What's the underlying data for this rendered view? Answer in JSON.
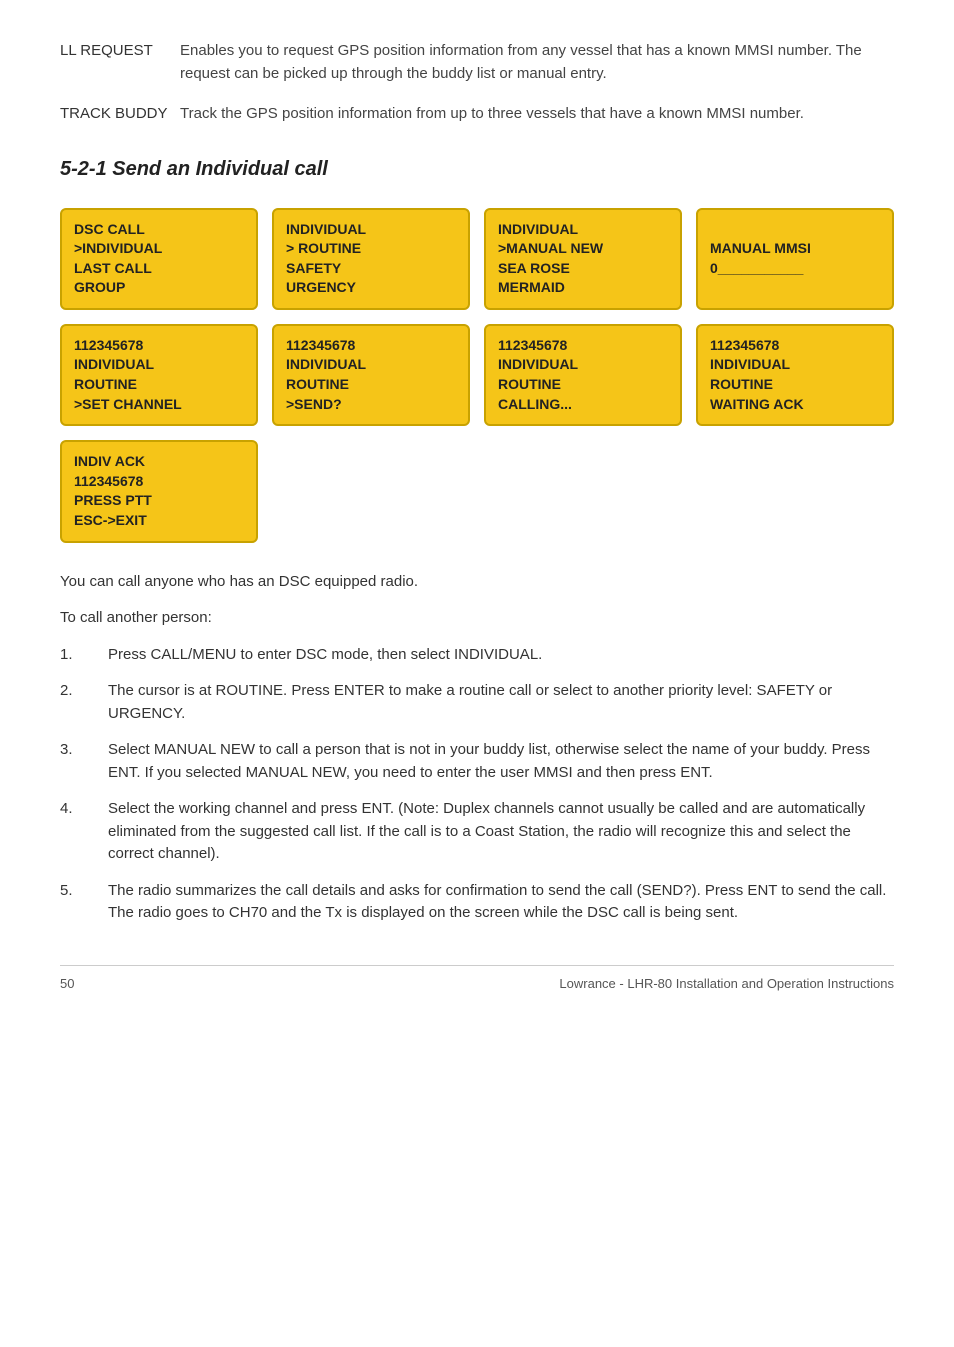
{
  "definitions": [
    {
      "term": "LL REQUEST",
      "description": "Enables you to request GPS position information from any vessel that has a known MMSI number.  The request can be picked up through the buddy list or manual entry."
    },
    {
      "term": "TRACK BUDDY",
      "description": "Track the GPS position information from up to three vessels that have a known MMSI number."
    }
  ],
  "section_heading": "5-2-1 Send an Individual call",
  "lcd_row1": [
    {
      "lines": [
        "DSC CALL",
        ">INDIVIDUAL",
        "LAST CALL",
        "GROUP"
      ]
    },
    {
      "lines": [
        "INDIVIDUAL",
        "> ROUTINE",
        "SAFETY",
        "URGENCY"
      ]
    },
    {
      "lines": [
        "INDIVIDUAL",
        ">MANUAL NEW",
        "SEA ROSE",
        "MERMAID"
      ]
    },
    {
      "lines": [
        "MANUAL MMSI",
        "0___________"
      ]
    }
  ],
  "lcd_row2": [
    {
      "lines": [
        "112345678",
        "INDIVIDUAL",
        "ROUTINE",
        ">SET CHANNEL"
      ]
    },
    {
      "lines": [
        "112345678",
        "INDIVIDUAL",
        "ROUTINE",
        ">SEND?"
      ]
    },
    {
      "lines": [
        "112345678",
        "INDIVIDUAL",
        "ROUTINE",
        "CALLING..."
      ]
    },
    {
      "lines": [
        "112345678",
        "INDIVIDUAL",
        "ROUTINE",
        "WAITING ACK"
      ]
    }
  ],
  "lcd_row3": [
    {
      "lines": [
        "INDIV ACK",
        "112345678",
        "PRESS PTT",
        "ESC->EXIT"
      ]
    }
  ],
  "prose": {
    "intro1": "You can call anyone who has an DSC equipped radio.",
    "intro2": "To call another person:",
    "steps": [
      {
        "num": "1.",
        "text": "Press CALL/MENU to enter DSC mode, then select INDIVIDUAL."
      },
      {
        "num": "2.",
        "text": "The cursor is at ROUTINE. Press ENTER to make a routine call or select to another priority level: SAFETY or URGENCY."
      },
      {
        "num": "3.",
        "text": "Select MANUAL NEW to call a person that is not in your buddy list, otherwise select the name of your buddy. Press ENT. If you selected MANUAL NEW, you need to enter the user MMSI and then press ENT."
      },
      {
        "num": "4.",
        "text": "Select the working channel and press ENT. (Note: Duplex channels cannot usually be called and are automatically eliminated from the suggested call list. If the call is to a Coast Station, the radio will recognize this and select the correct channel)."
      },
      {
        "num": "5.",
        "text": "The radio summarizes the call details and asks for confirmation to send the call (SEND?). Press ENT to send the call. The radio goes to CH70 and the Tx is displayed on the screen while the DSC call is being sent."
      }
    ]
  },
  "footer": {
    "page_num": "50",
    "title": "Lowrance - LHR-80 Installation and Operation Instructions"
  }
}
